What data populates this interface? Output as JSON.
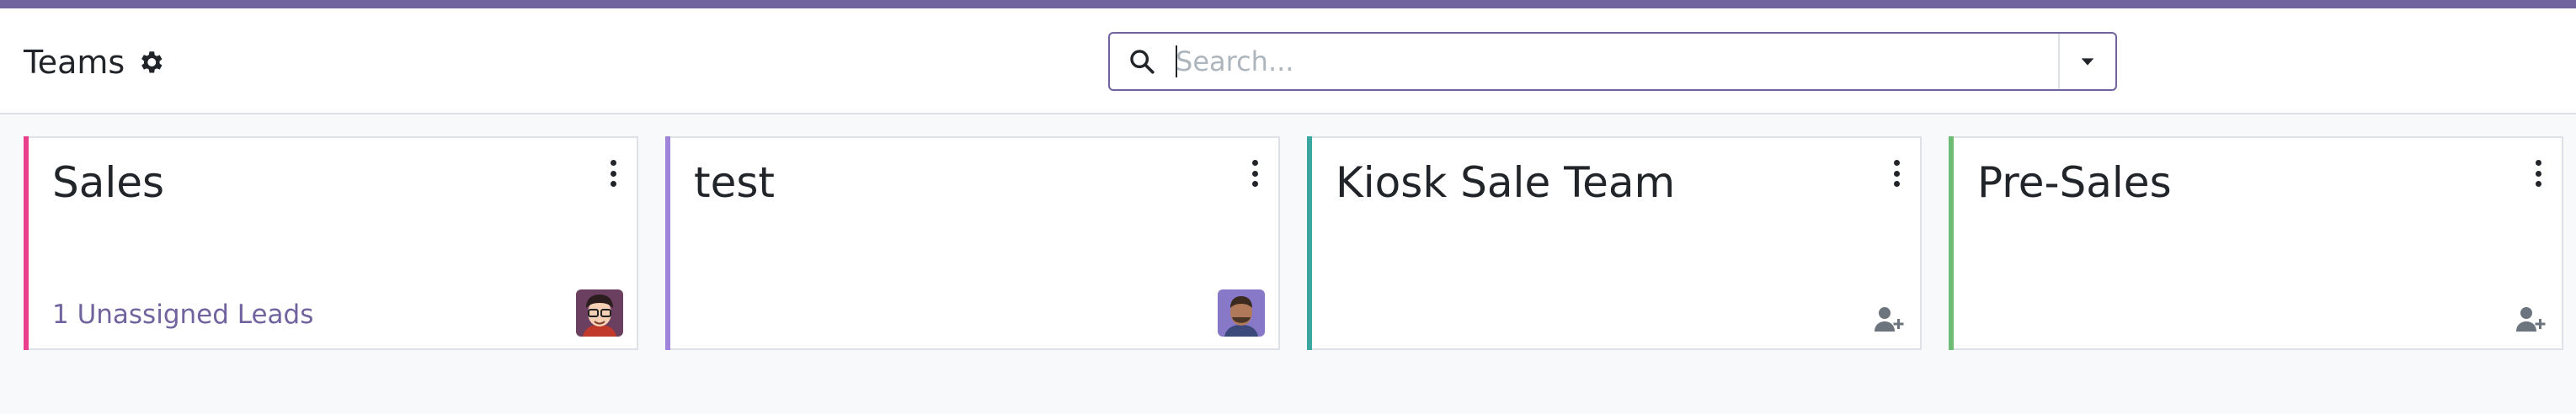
{
  "app": {
    "accent_color": "#71639e"
  },
  "breadcrumb": {
    "title": "Teams",
    "settings_icon": "gear-icon"
  },
  "search": {
    "placeholder": "Search...",
    "value": "",
    "icon": "search-icon",
    "toggle_icon": "caret-down-icon"
  },
  "cards": [
    {
      "name": "Sales",
      "color": "#e83e8c",
      "link_text": "1 Unassigned Leads",
      "footer_icon": "avatar"
    },
    {
      "name": "test",
      "color": "#a083db",
      "link_text": "",
      "footer_icon": "avatar"
    },
    {
      "name": "Kiosk Sale Team",
      "color": "#3aa7a0",
      "link_text": "",
      "footer_icon": "add-user-icon"
    },
    {
      "name": "Pre-Sales",
      "color": "#6dbd75",
      "link_text": "",
      "footer_icon": "add-user-icon"
    }
  ]
}
